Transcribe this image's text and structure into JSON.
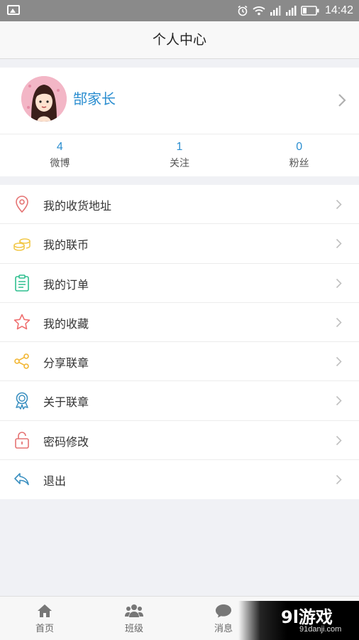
{
  "status_bar": {
    "time": "14:42"
  },
  "header": {
    "title": "个人中心"
  },
  "profile": {
    "name": "郜家长"
  },
  "stats": [
    {
      "value": "4",
      "label": "微博"
    },
    {
      "value": "1",
      "label": "关注"
    },
    {
      "value": "0",
      "label": "粉丝"
    }
  ],
  "menu": [
    {
      "label": "我的收货地址",
      "icon": "location-pin-icon",
      "color": "#e57373"
    },
    {
      "label": "我的联币",
      "icon": "coins-icon",
      "color": "#f2c94c"
    },
    {
      "label": "我的订单",
      "icon": "clipboard-icon",
      "color": "#2fbf8f"
    },
    {
      "label": "我的收藏",
      "icon": "star-icon",
      "color": "#ef6f6f"
    },
    {
      "label": "分享联章",
      "icon": "share-icon",
      "color": "#f2b632"
    },
    {
      "label": "关于联章",
      "icon": "badge-icon",
      "color": "#3a8fc0"
    },
    {
      "label": "密码修改",
      "icon": "lock-icon",
      "color": "#e57373"
    },
    {
      "label": "退出",
      "icon": "reply-icon",
      "color": "#3a8fc0"
    }
  ],
  "tabs": [
    {
      "label": "首页",
      "icon": "home-icon"
    },
    {
      "label": "班级",
      "icon": "group-icon"
    },
    {
      "label": "消息",
      "icon": "chat-icon"
    }
  ],
  "watermark": {
    "mark": "9l游戏",
    "url": "91danji.com"
  },
  "colors": {
    "accent": "#2b8ed0",
    "page_bg": "#f0f1f5",
    "status_bar": "#8a8a8a"
  }
}
